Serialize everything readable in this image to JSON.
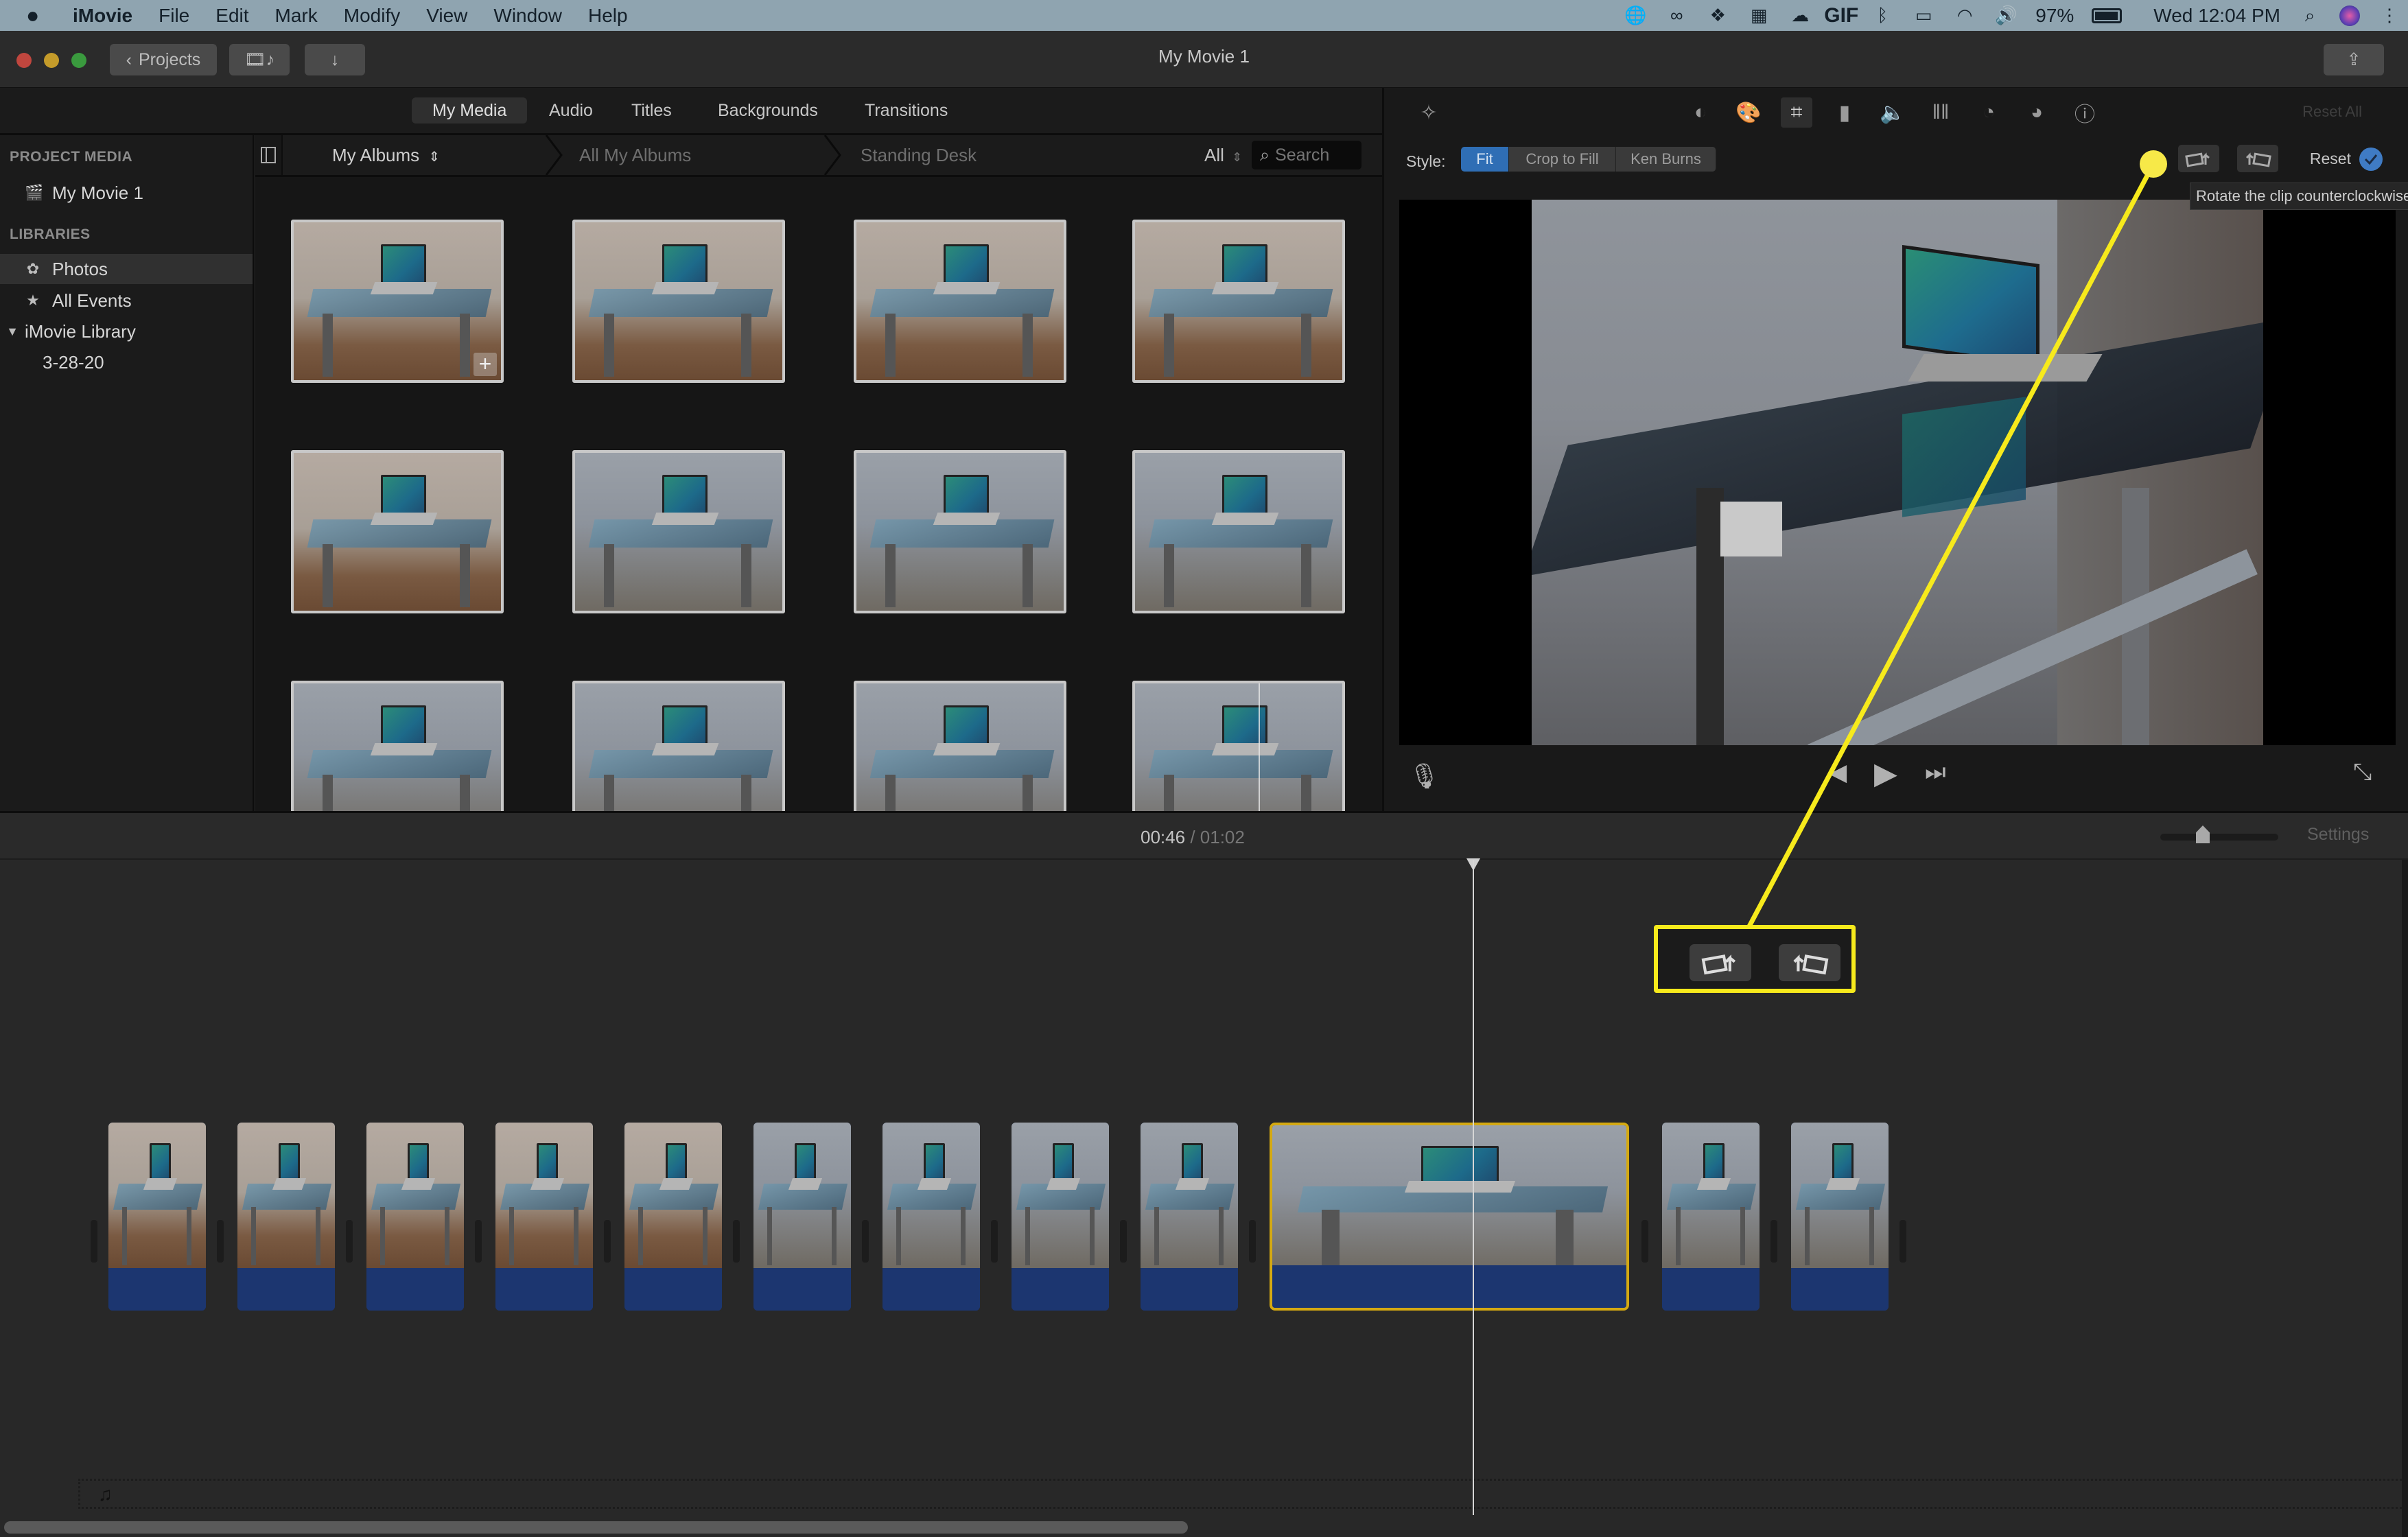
{
  "menubar": {
    "apple_icon": "apple-logo-icon",
    "app_name": "iMovie",
    "items": [
      "File",
      "Edit",
      "Mark",
      "Modify",
      "View",
      "Window",
      "Help"
    ],
    "tray_icons": [
      "globe-icon",
      "binoculars-icon",
      "dropbox-icon",
      "keyboard-grid-icon",
      "cloud-upload-icon",
      "gif-icon",
      "bluetooth-icon",
      "airplay-icon",
      "wifi-icon",
      "volume-icon"
    ],
    "gif_label": "GIF",
    "battery_percent": "97%",
    "clock": "Wed 12:04 PM"
  },
  "toolbar": {
    "projects_label": "Projects",
    "window_title": "My Movie 1"
  },
  "tabs": [
    {
      "label": "My Media",
      "active": true
    },
    {
      "label": "Audio",
      "active": false
    },
    {
      "label": "Titles",
      "active": false
    },
    {
      "label": "Backgrounds",
      "active": false
    },
    {
      "label": "Transitions",
      "active": false
    }
  ],
  "sidebar": {
    "project_media_header": "PROJECT MEDIA",
    "project": "My Movie 1",
    "libraries_header": "LIBRARIES",
    "items": [
      {
        "label": "Photos",
        "icon": "photos-flower-icon",
        "selected": true
      },
      {
        "label": "All Events",
        "icon": "star-event-icon",
        "selected": false
      },
      {
        "label": "iMovie Library",
        "icon": "disclosure-triangle-icon",
        "selected": false
      },
      {
        "label": "3-28-20",
        "icon": "",
        "selected": false
      }
    ]
  },
  "browser": {
    "album_selector": "My Albums",
    "breadcrumbs": [
      "All My Albums",
      "Standing Desk"
    ],
    "filter": "All",
    "search_placeholder": "Search",
    "thumbnail_count": 12
  },
  "viewer": {
    "adjust_tools": [
      "color-balance",
      "color-correction",
      "cropping",
      "stabilization",
      "volume",
      "noise-reduction-equalizer",
      "speed",
      "clip-filter",
      "clip-info"
    ],
    "active_tool": "cropping",
    "reset_all_label": "Reset All",
    "style_label": "Style:",
    "style_options": [
      "Fit",
      "Crop to Fill",
      "Ken Burns"
    ],
    "style_selected": "Fit",
    "reset_label": "Reset",
    "tooltip": "Rotate the clip counterclockwise"
  },
  "timeline": {
    "current_time": "00:46",
    "separator": "/",
    "total_time": "01:02",
    "settings_label": "Settings",
    "zoom_level": 0.35,
    "clip_count": 12,
    "selected_clip_index": 9,
    "scroll_fraction": 0.49
  },
  "annotation": {
    "highlight_color": "#f7ea1c",
    "callout": "rotate buttons"
  },
  "colors": {
    "accent_blue": "#2f6eb5",
    "selection_yellow": "#d4a912",
    "audio_track_blue": "#1c3670"
  }
}
